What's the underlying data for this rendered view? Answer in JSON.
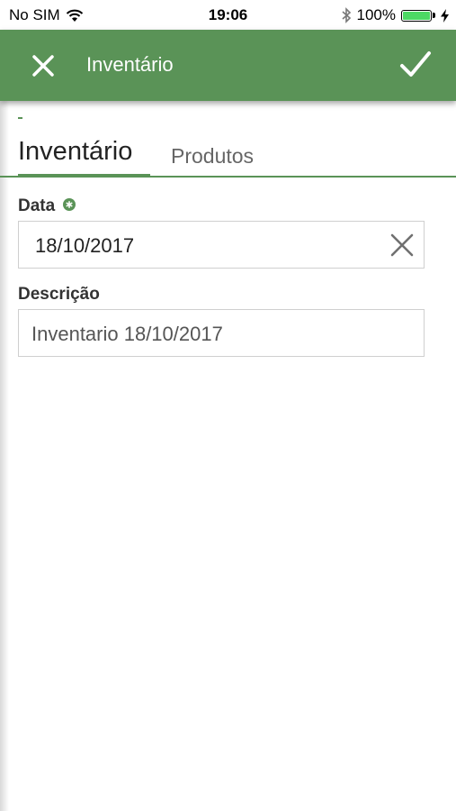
{
  "status_bar": {
    "carrier": "No SIM",
    "time": "19:06",
    "battery_percent": "100%",
    "battery_level": 1.0,
    "battery_color": "#4cd964"
  },
  "app_bar": {
    "title": "Inventário",
    "color": "#5a9357",
    "close_icon": "close-icon",
    "confirm_icon": "check-icon"
  },
  "accent_color": "#5a9357",
  "tabs": [
    {
      "label": "Inventário",
      "active": true
    },
    {
      "label": "Produtos",
      "active": false
    }
  ],
  "form": {
    "data": {
      "label": "Data",
      "required": true,
      "value": "18/10/2017"
    },
    "descricao": {
      "label": "Descrição",
      "value": "Inventario 18/10/2017"
    }
  }
}
